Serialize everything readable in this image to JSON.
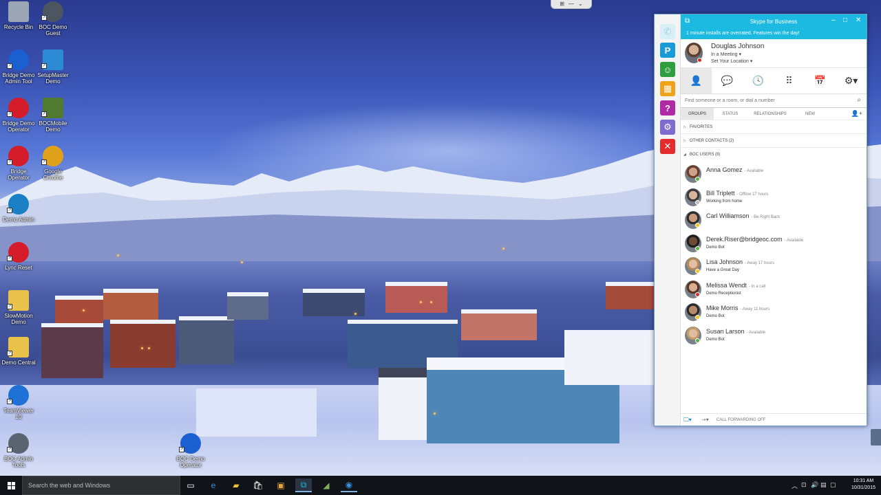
{
  "colors": {
    "skype_accent": "#1cb9e0",
    "available": "#57b33a",
    "away": "#f2c318",
    "busy": "#d62b2b",
    "offline": "#bdbdbd"
  },
  "remote_bar": {
    "pin": "⊞",
    "minimize": "—",
    "collapse": "⌄"
  },
  "desktop_icons": [
    {
      "label": "Recycle Bin",
      "icon": "recycle-bin-icon",
      "color": "#9aa5b5"
    },
    {
      "label": "BOC Demo Guest",
      "icon": "boc-demo-guest-icon",
      "color": "#4b5660"
    },
    {
      "label": "Bridge Demo Admin Tool",
      "icon": "bridge-admin-icon",
      "color": "#1b5fd0"
    },
    {
      "label": "SetupMaster Demo",
      "icon": "setup-master-icon",
      "color": "#2d8bd6"
    },
    {
      "label": "Bridge Demo Operator",
      "icon": "bridge-operator-icon",
      "color": "#d51c2a"
    },
    {
      "label": "BOCMobile Demo",
      "icon": "boc-mobile-icon",
      "color": "#4f7a2f"
    },
    {
      "label": "Bridge Operator",
      "icon": "bridge-operator-red-icon",
      "color": "#d51c2a"
    },
    {
      "label": "Google Chrome",
      "icon": "chrome-icon",
      "color": "#e0a11a"
    },
    {
      "label": "Demo Admin",
      "icon": "demo-admin-icon",
      "color": "#1a7fc4"
    },
    {
      "label": "Lync Reset",
      "icon": "lync-reset-icon",
      "color": "#d51c2a"
    },
    {
      "label": "SlowMotion Demo",
      "icon": "folder-icon",
      "color": "#e8c24a"
    },
    {
      "label": "Demo Central",
      "icon": "folder-icon",
      "color": "#e8c24a"
    },
    {
      "label": "TeamViewer 10",
      "icon": "teamviewer-icon",
      "color": "#1e72d6"
    },
    {
      "label": "BOC Admin Tools",
      "icon": "boc-admin-tools-icon",
      "color": "#5a6471"
    },
    {
      "label": "BOC Demo Operator",
      "icon": "boc-demo-operator-icon",
      "color": "#1b5fd0"
    }
  ],
  "skype": {
    "title": "Skype for Business",
    "notice": "1 minute installs are overrated. Features win the day!",
    "user": {
      "name": "Douglas Johnson",
      "status": "In a Meeting ▾",
      "location": "Set Your Location ▾"
    },
    "search_placeholder": "Find someone or a room, or dial a number",
    "subtabs": [
      "GROUPS",
      "STATUS",
      "RELATIONSHIPS",
      "NEW"
    ],
    "groups": [
      "FAVORITES",
      "OTHER CONTACTS (2)",
      "BOC USERS (8)"
    ],
    "contacts": [
      {
        "name": "Anna Gomez",
        "status": "- Available",
        "note": "",
        "presence": "#57b33a",
        "skin": "#cfa38a",
        "hair": "#6a3e28"
      },
      {
        "name": "Bill Triplett",
        "status": "- Offline 17 hours",
        "note": "Working from home",
        "presence": "#bdbdbd",
        "skin": "#d9b49c",
        "hair": "#3b3b3b"
      },
      {
        "name": "Carl Williamson",
        "status": "- Be Right Back",
        "note": "",
        "presence": "#f2c318",
        "skin": "#c89a7c",
        "hair": "#2d2d2d"
      },
      {
        "name": "Derek.Riser@bridgeoc.com",
        "status": "- Available",
        "note": "Demo Bot",
        "presence": "#57b33a",
        "skin": "#6b4a38",
        "hair": "#1d1d1d"
      },
      {
        "name": "Lisa Johnson",
        "status": "- Away 17 hours",
        "note": "Have a Great Day",
        "presence": "#f2c318",
        "skin": "#e3c0a4",
        "hair": "#b58a5a"
      },
      {
        "name": "Melissa Wendt",
        "status": "- In a call",
        "note": "Demo Receptionist",
        "presence": "#d62b2b",
        "skin": "#d9ad90",
        "hair": "#5a3422"
      },
      {
        "name": "Mike Morris",
        "status": "- Away 11 hours",
        "note": "Demo Bot",
        "presence": "#f2c318",
        "skin": "#b88a6c",
        "hair": "#2a2a2a"
      },
      {
        "name": "Susan Larson",
        "status": "- Available",
        "note": "Demo Bot",
        "presence": "#57b33a",
        "skin": "#e0bca0",
        "hair": "#c49a6c"
      }
    ],
    "footer": {
      "forwarding": "CALL FORWARDING OFF"
    }
  },
  "taskbar": {
    "search_placeholder": "Search the web and Windows",
    "time": "10:31 AM",
    "date": "10/31/2015"
  }
}
